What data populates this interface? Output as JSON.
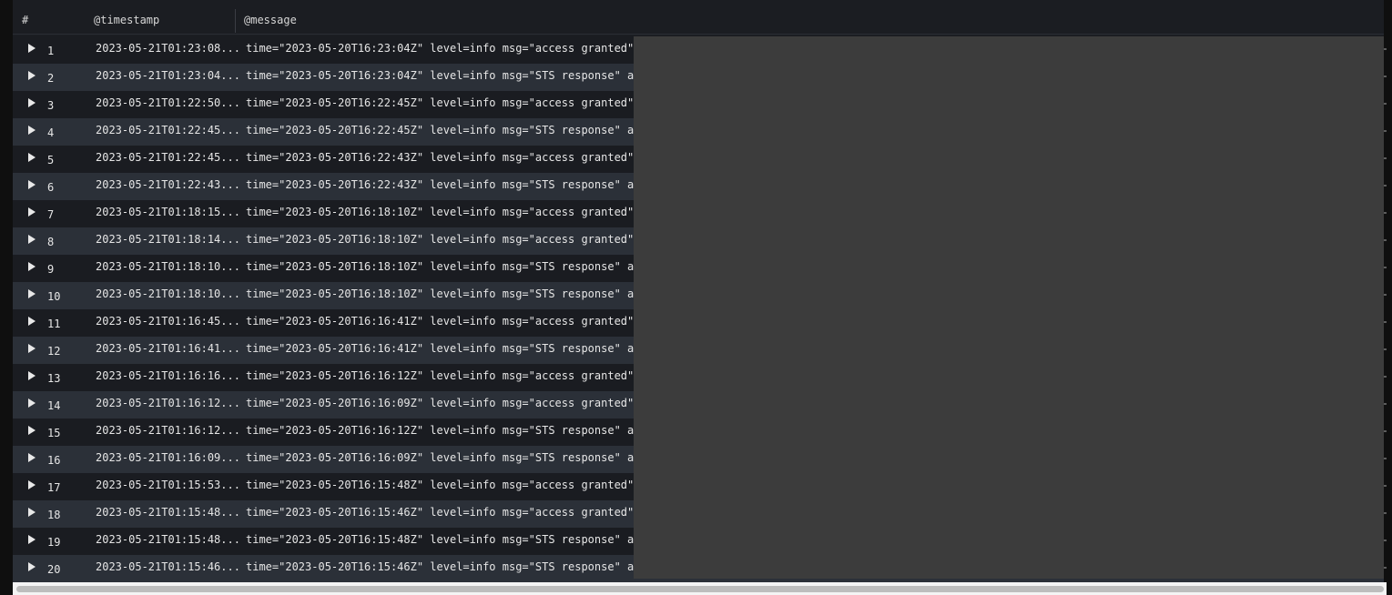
{
  "table": {
    "columns": {
      "num": "#",
      "timestamp": "@timestamp",
      "message": "@message"
    },
    "rows": [
      {
        "num": "1",
        "timestamp": "2023-05-21T01:23:08...",
        "message": "time=\"2023-05-20T16:23:04Z\" level=info msg=\"access granted\""
      },
      {
        "num": "2",
        "timestamp": "2023-05-21T01:23:04...",
        "message": "time=\"2023-05-20T16:23:04Z\" level=info msg=\"STS response\" a"
      },
      {
        "num": "3",
        "timestamp": "2023-05-21T01:22:50...",
        "message": "time=\"2023-05-20T16:22:45Z\" level=info msg=\"access granted\""
      },
      {
        "num": "4",
        "timestamp": "2023-05-21T01:22:45...",
        "message": "time=\"2023-05-20T16:22:45Z\" level=info msg=\"STS response\" a"
      },
      {
        "num": "5",
        "timestamp": "2023-05-21T01:22:45...",
        "message": "time=\"2023-05-20T16:22:43Z\" level=info msg=\"access granted\""
      },
      {
        "num": "6",
        "timestamp": "2023-05-21T01:22:43...",
        "message": "time=\"2023-05-20T16:22:43Z\" level=info msg=\"STS response\" a"
      },
      {
        "num": "7",
        "timestamp": "2023-05-21T01:18:15...",
        "message": "time=\"2023-05-20T16:18:10Z\" level=info msg=\"access granted\""
      },
      {
        "num": "8",
        "timestamp": "2023-05-21T01:18:14...",
        "message": "time=\"2023-05-20T16:18:10Z\" level=info msg=\"access granted\""
      },
      {
        "num": "9",
        "timestamp": "2023-05-21T01:18:10...",
        "message": "time=\"2023-05-20T16:18:10Z\" level=info msg=\"STS response\" a"
      },
      {
        "num": "10",
        "timestamp": "2023-05-21T01:18:10...",
        "message": "time=\"2023-05-20T16:18:10Z\" level=info msg=\"STS response\" a"
      },
      {
        "num": "11",
        "timestamp": "2023-05-21T01:16:45...",
        "message": "time=\"2023-05-20T16:16:41Z\" level=info msg=\"access granted\""
      },
      {
        "num": "12",
        "timestamp": "2023-05-21T01:16:41...",
        "message": "time=\"2023-05-20T16:16:41Z\" level=info msg=\"STS response\" a"
      },
      {
        "num": "13",
        "timestamp": "2023-05-21T01:16:16...",
        "message": "time=\"2023-05-20T16:16:12Z\" level=info msg=\"access granted\""
      },
      {
        "num": "14",
        "timestamp": "2023-05-21T01:16:12...",
        "message": "time=\"2023-05-20T16:16:09Z\" level=info msg=\"access granted\""
      },
      {
        "num": "15",
        "timestamp": "2023-05-21T01:16:12...",
        "message": "time=\"2023-05-20T16:16:12Z\" level=info msg=\"STS response\" a"
      },
      {
        "num": "16",
        "timestamp": "2023-05-21T01:16:09...",
        "message": "time=\"2023-05-20T16:16:09Z\" level=info msg=\"STS response\" a"
      },
      {
        "num": "17",
        "timestamp": "2023-05-21T01:15:53...",
        "message": "time=\"2023-05-20T16:15:48Z\" level=info msg=\"access granted\""
      },
      {
        "num": "18",
        "timestamp": "2023-05-21T01:15:48...",
        "message": "time=\"2023-05-20T16:15:46Z\" level=info msg=\"access granted\""
      },
      {
        "num": "19",
        "timestamp": "2023-05-21T01:15:48...",
        "message": "time=\"2023-05-20T16:15:48Z\" level=info msg=\"STS response\" a"
      },
      {
        "num": "20",
        "timestamp": "2023-05-21T01:15:46...",
        "message": "time=\"2023-05-20T16:15:46Z\" level=info msg=\"STS response\" a"
      }
    ]
  },
  "icons": {
    "expand": "triangle-right-icon"
  },
  "colors": {
    "row_odd": "#1a1c21",
    "row_even": "#2b3038",
    "overlay": "#3c3c3c",
    "text": "#e6e6e6"
  }
}
